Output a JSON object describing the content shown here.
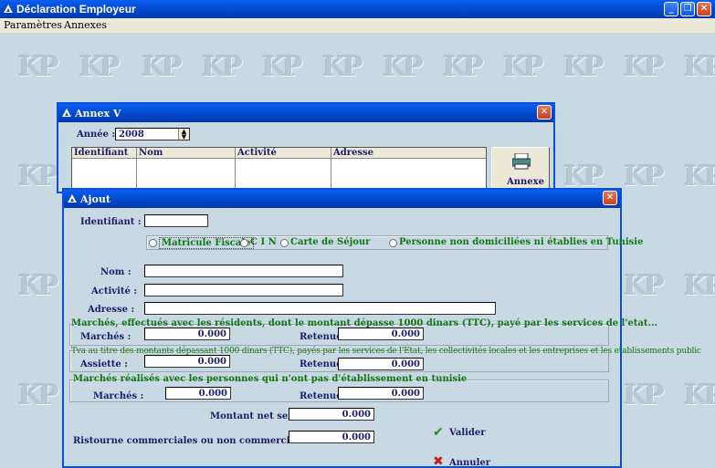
{
  "app": {
    "title": "Déclaration Employeur"
  },
  "menu": {
    "parametres": "Paramètres",
    "annexes": "Annexes"
  },
  "background": {
    "logo_text": "KP"
  },
  "annex_window": {
    "title": "Annex V",
    "year_label": "Année :",
    "year_value": "2008",
    "columns": [
      "Identifiant",
      "Nom",
      "Activité",
      "Adresse"
    ],
    "annexe_button": "Annexe"
  },
  "ajout": {
    "title": "Ajout",
    "identifiant_label": "Identifiant :",
    "identifiant_value": "",
    "radio_options": [
      "Matricule Fiscale",
      "C I N",
      "Carte de Séjour",
      "Personne non domiciliées ni établies en Tunisie"
    ],
    "selected_radio": "Matricule Fiscale",
    "nom_label": "Nom :",
    "activite_label": "Activité :",
    "adresse_label": "Adresse :",
    "section1_title": "Marchés, effectués avec les résidents, dont le montant dépasse 1000 dinars (TTC), payé par les services de l'etat...",
    "section1_marches_label": "Marchés :",
    "section1_marches_value": "0.000",
    "section1_retenues_label": "Retenues",
    "section1_retenues_value": "0.000",
    "section2_title": "Tva au titre des montants dépassant 1000 dinars (TTC), payés par les services de l'Etat, les collectivités locales et les entreprises et les etablissements public",
    "section2_assiette_label": "Assiette :",
    "section2_assiette_value": "0.000",
    "section2_retenues_label": "Retenues",
    "section2_retenues_value": "0.000",
    "section3_title": "Marchés réalisés avec les personnes qui n'ont pas d'établissement en tunisie",
    "section3_marches_label": "Marchés :",
    "section3_marches_value": "0.000",
    "section3_retenues_label": "Retenues :",
    "section3_retenues_value": "0.000",
    "montant_label": "Montant net servi :",
    "montant_value": "0.000",
    "ristourne_label": "Ristourne commerciales ou non commercilaes accordées",
    "ristourne_value": "0.000",
    "valider_label": "Valider",
    "annuler_label": "Annuler"
  },
  "colors": {
    "titlebar": "#0346c8",
    "green_text": "#117711",
    "label_text": "#1d1d6a",
    "desktop_bg": "#c9d9e4"
  }
}
